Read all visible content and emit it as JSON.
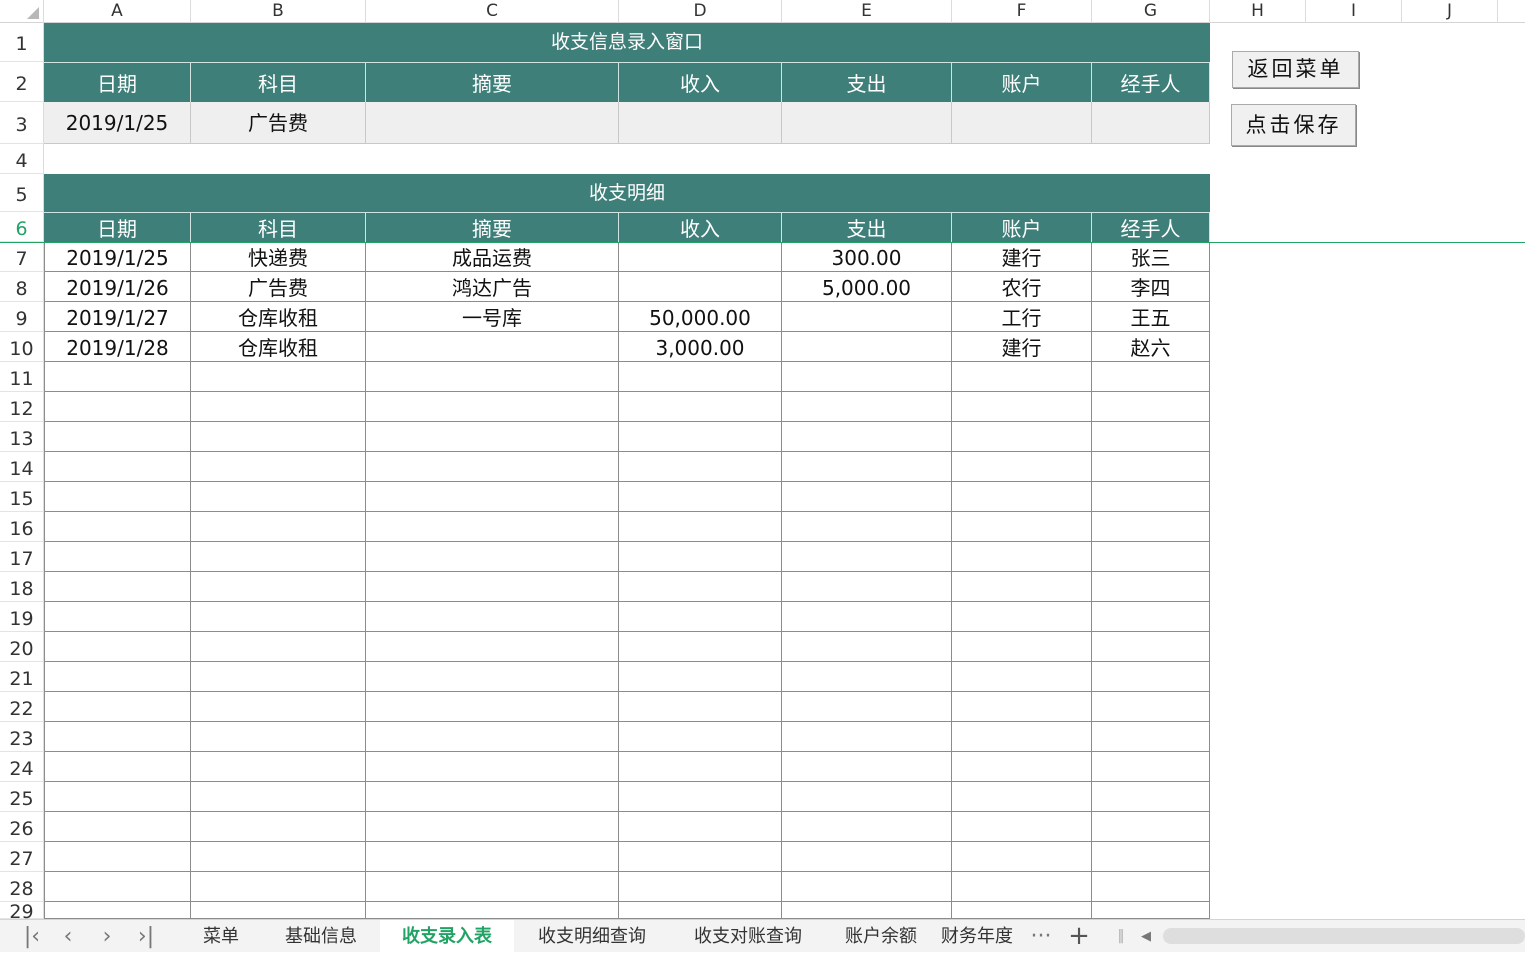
{
  "columns": [
    "A",
    "B",
    "C",
    "D",
    "E",
    "F",
    "G",
    "H",
    "I",
    "J"
  ],
  "rows": [
    "1",
    "2",
    "3",
    "4",
    "5",
    "6",
    "7",
    "8",
    "9",
    "10",
    "11",
    "12",
    "13",
    "14",
    "15",
    "16",
    "17",
    "18",
    "19",
    "20",
    "21",
    "22",
    "23",
    "24",
    "25",
    "26",
    "27",
    "28",
    "29"
  ],
  "active_row": "6",
  "entry": {
    "title": "收支信息录入窗口",
    "headers": [
      "日期",
      "科目",
      "摘要",
      "收入",
      "支出",
      "账户",
      "经手人"
    ],
    "values": [
      "2019/1/25",
      "广告费",
      "",
      "",
      "",
      "",
      ""
    ]
  },
  "detail": {
    "title": "收支明细",
    "headers": [
      "日期",
      "科目",
      "摘要",
      "收入",
      "支出",
      "账户",
      "经手人"
    ],
    "records": [
      [
        "2019/1/25",
        "快递费",
        "成品运费",
        "",
        "300.00",
        "建行",
        "张三"
      ],
      [
        "2019/1/26",
        "广告费",
        "鸿达广告",
        "",
        "5,000.00",
        "农行",
        "李四"
      ],
      [
        "2019/1/27",
        "仓库收租",
        "一号库",
        "50,000.00",
        "",
        "工行",
        "王五"
      ],
      [
        "2019/1/28",
        "仓库收租",
        "",
        "3,000.00",
        "",
        "建行",
        "赵六"
      ]
    ]
  },
  "buttons": {
    "back_menu": "返回菜单",
    "save": "点击保存"
  },
  "sheet_tabs": [
    "菜单",
    "基础信息",
    "收支录入表",
    "收支明细查询",
    "收支对账查询",
    "账户余额",
    "财务年度"
  ],
  "active_tab": "收支录入表",
  "tab_nav": {
    "first": "|<",
    "prev": "<",
    "next": ">",
    "last": ">|",
    "more": "···",
    "add": "+"
  },
  "colors": {
    "header_fill": "#3e7f79",
    "active_tab": "#21a366",
    "input_fill": "#efefef"
  }
}
